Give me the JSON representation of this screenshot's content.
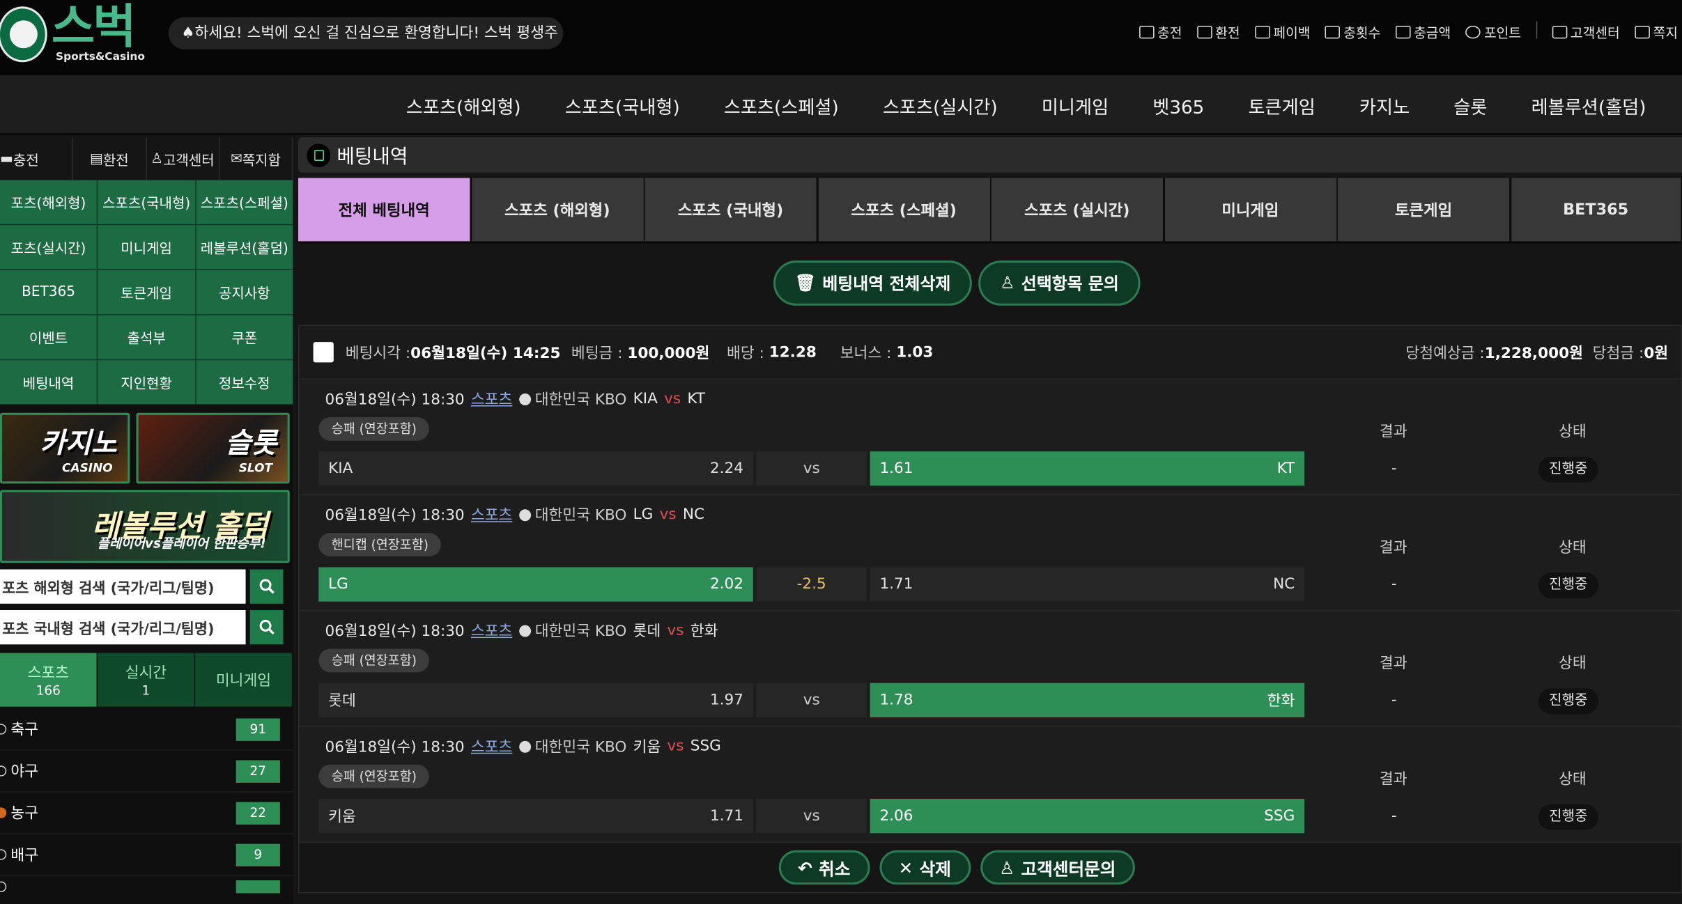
{
  "header": {
    "logo_text": "스벅",
    "logo_sub": "Sports&Casino",
    "notice": "하세요! 스벅에 오신 걸 진심으로 환영합니다! 스벅 평생주",
    "links": [
      "충전",
      "환전",
      "페이백",
      "충횟수",
      "충금액",
      "포인트",
      "고객센터",
      "쪽지"
    ]
  },
  "mainnav": [
    "스포츠(해외형)",
    "스포츠(국내형)",
    "스포츠(스페셜)",
    "스포츠(실시간)",
    "미니게임",
    "벳365",
    "토큰게임",
    "카지노",
    "슬롯",
    "레볼루션(홀덤)"
  ],
  "sidebar": {
    "quick": [
      "충전",
      "환전",
      "고객센터",
      "쪽지함"
    ],
    "grid": [
      "포츠(해외형)",
      "스포츠(국내형)",
      "스포츠(스페셜)",
      "포츠(실시간)",
      "미니게임",
      "레볼루션(홀덤)",
      "BET365",
      "토큰게임",
      "공지사항",
      "이벤트",
      "출석부",
      "쿠폰",
      "베팅내역",
      "지인현황",
      "정보수정"
    ],
    "banners": {
      "casino_title": "카지노",
      "casino_sub": "CASINO",
      "slot_title": "슬롯",
      "slot_sub": "SLOT",
      "holdem_title": "레볼루션 홀덤",
      "holdem_sub": "플레이어vs플레이어 한판승부!"
    },
    "search_overseas": "포츠 해외형 검색 (국가/리그/팀명)",
    "search_domestic": "포츠 국내형 검색 (국가/리그/팀명)",
    "sport_tabs": [
      {
        "label": "스포츠",
        "count": "166"
      },
      {
        "label": "실시간",
        "count": "1"
      },
      {
        "label": "미니게임",
        "count": ""
      }
    ],
    "sports": [
      {
        "name": "축구",
        "count": "91"
      },
      {
        "name": "야구",
        "count": "27"
      },
      {
        "name": "농구",
        "count": "22"
      },
      {
        "name": "배구",
        "count": "9"
      }
    ]
  },
  "content": {
    "title": "베팅내역",
    "tabs": [
      "전체 베팅내역",
      "스포츠 (해외형)",
      "스포츠 (국내형)",
      "스포츠 (스페셜)",
      "스포츠 (실시간)",
      "미니게임",
      "토큰게임",
      "BET365"
    ],
    "delete_all": "베팅내역 전체삭제",
    "inquiry": "선택항목 문의",
    "bet": {
      "time_label": "베팅시각 :",
      "time": "06월18일(수) 14:25",
      "amount_label": "베팅금 :",
      "amount": "100,000원",
      "odds_label": "배당 :",
      "odds": "12.28",
      "bonus_label": "보너스 :",
      "bonus": "1.03",
      "expected_label": "당첨예상금 :",
      "expected": "1,228,000원",
      "win_label": "당첨금 :",
      "win": "0원"
    },
    "result_label": "결과",
    "status_label": "상태",
    "matches": [
      {
        "time": "06월18일(수) 18:30",
        "sport": "스포츠",
        "league": "대한민국 KBO",
        "home": "KIA",
        "vs": "vs",
        "away": "KT",
        "type": "승패 (연장포함)",
        "home_odds": "2.24",
        "mid": "vs",
        "away_odds": "1.61",
        "result": "-",
        "status": "진행중"
      },
      {
        "time": "06월18일(수) 18:30",
        "sport": "스포츠",
        "league": "대한민국 KBO",
        "home": "LG",
        "vs": "vs",
        "away": "NC",
        "type": "핸디캡 (연장포함)",
        "home_odds": "2.02",
        "mid": "-2.5",
        "away_odds": "1.71",
        "result": "-",
        "status": "진행중"
      },
      {
        "time": "06월18일(수) 18:30",
        "sport": "스포츠",
        "league": "대한민국 KBO",
        "home": "롯데",
        "vs": "vs",
        "away": "한화",
        "type": "승패 (연장포함)",
        "home_odds": "1.97",
        "mid": "vs",
        "away_odds": "1.78",
        "result": "-",
        "status": "진행중"
      },
      {
        "time": "06월18일(수) 18:30",
        "sport": "스포츠",
        "league": "대한민국 KBO",
        "home": "키움",
        "vs": "vs",
        "away": "SSG",
        "type": "승패 (연장포함)",
        "home_odds": "1.71",
        "mid": "vs",
        "away_odds": "2.06",
        "result": "-",
        "status": "진행중"
      }
    ],
    "cancel": "취소",
    "delete": "삭제",
    "cs": "고객센터문의"
  }
}
